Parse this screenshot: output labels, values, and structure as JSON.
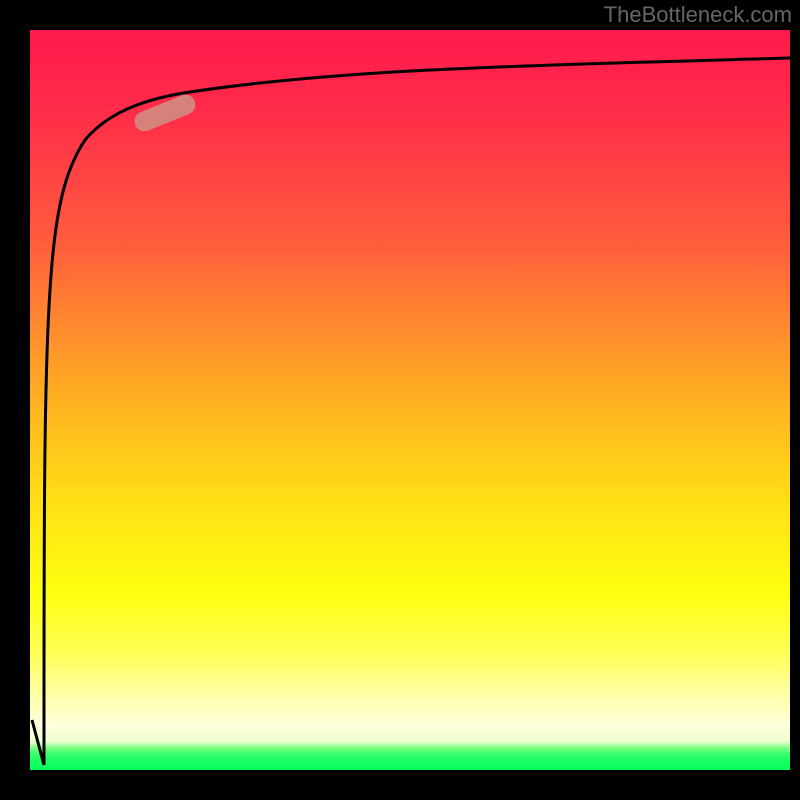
{
  "watermark": "TheBottleneck.com",
  "chart_data": {
    "type": "line",
    "title": "",
    "xlabel": "",
    "ylabel": "",
    "xlim": [
      0,
      100
    ],
    "ylim": [
      0,
      100
    ],
    "gradient": {
      "top_color": "#ff1a4d",
      "mid_orange": "#ff8a2e",
      "mid_yellow": "#ffff10",
      "bottom_color": "#00ff5c"
    },
    "series": [
      {
        "name": "curve",
        "x": [
          2,
          2.5,
          3,
          3.5,
          4,
          4.5,
          5,
          6,
          8,
          10,
          14,
          18,
          25,
          35,
          50,
          70,
          85,
          100
        ],
        "values": [
          3,
          35,
          55,
          68,
          76,
          80,
          83,
          86,
          88,
          89,
          90,
          90.7,
          91.5,
          92.3,
          93,
          93.8,
          94.3,
          95
        ]
      }
    ],
    "highlight": {
      "name": "highlight-pill",
      "x_center_pct": 18,
      "y_center_pct_from_top": 12,
      "fill": "#d18c82",
      "opacity": 0.9
    }
  }
}
